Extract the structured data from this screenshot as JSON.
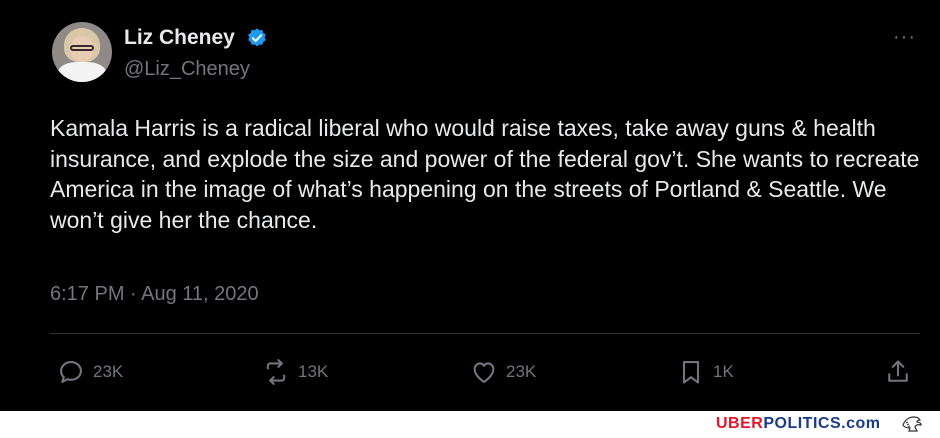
{
  "tweet": {
    "name": "Liz Cheney",
    "handle": "@Liz_Cheney",
    "more_label": "···",
    "text": "Kamala Harris is a radical liberal who would raise taxes, take away guns & health insurance, and explode the size and power of the federal gov’t. She wants to recreate America in the image of what’s happening on the streets of Portland & Seattle. We won’t give her the chance.",
    "timestamp": "6:17 PM · Aug 11, 2020",
    "verified_color": "#1d9bf0",
    "actions": {
      "replies": "23K",
      "retweets": "13K",
      "likes": "23K",
      "bookmarks": "1K"
    }
  },
  "watermark": {
    "part1": "UBER",
    "part2": "POLITICS",
    "part3": ".com"
  }
}
